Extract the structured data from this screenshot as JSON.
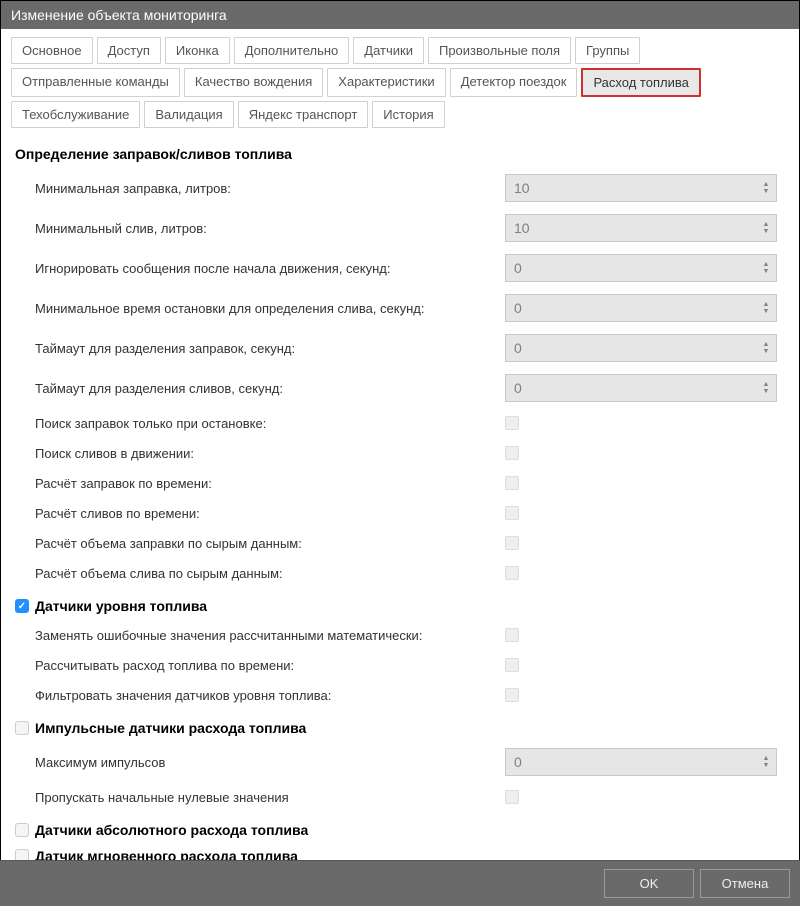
{
  "title": "Изменение объекта мониторинга",
  "tabs": {
    "row1": [
      {
        "label": "Основное",
        "active": false
      },
      {
        "label": "Доступ",
        "active": false
      },
      {
        "label": "Иконка",
        "active": false
      },
      {
        "label": "Дополнительно",
        "active": false
      },
      {
        "label": "Датчики",
        "active": false
      },
      {
        "label": "Произвольные поля",
        "active": false
      },
      {
        "label": "Группы",
        "active": false
      }
    ],
    "row2": [
      {
        "label": "Отправленные команды",
        "active": false
      },
      {
        "label": "Качество вождения",
        "active": false
      },
      {
        "label": "Характеристики",
        "active": false
      },
      {
        "label": "Детектор поездок",
        "active": false
      },
      {
        "label": "Расход топлива",
        "active": true
      }
    ],
    "row3": [
      {
        "label": "Техобслуживание",
        "active": false
      },
      {
        "label": "Валидация",
        "active": false
      },
      {
        "label": "Яндекс транспорт",
        "active": false
      },
      {
        "label": "История",
        "active": false
      }
    ]
  },
  "sections": {
    "s1": {
      "title": "Определение заправок/сливов топлива",
      "rows": [
        {
          "label": "Минимальная заправка, литров:",
          "type": "spinner",
          "value": "10"
        },
        {
          "label": "Минимальный слив, литров:",
          "type": "spinner",
          "value": "10"
        },
        {
          "label": "Игнорировать сообщения после начала движения, секунд:",
          "type": "spinner",
          "value": "0"
        },
        {
          "label": "Минимальное время остановки для определения слива, секунд:",
          "type": "spinner",
          "value": "0"
        },
        {
          "label": "Таймаут для разделения заправок, секунд:",
          "type": "spinner",
          "value": "0"
        },
        {
          "label": "Таймаут для разделения сливов, секунд:",
          "type": "spinner",
          "value": "0"
        },
        {
          "label": "Поиск заправок только при остановке:",
          "type": "checkbox"
        },
        {
          "label": "Поиск сливов в движении:",
          "type": "checkbox"
        },
        {
          "label": "Расчёт заправок по времени:",
          "type": "checkbox"
        },
        {
          "label": "Расчёт сливов по времени:",
          "type": "checkbox"
        },
        {
          "label": "Расчёт объема заправки по сырым данным:",
          "type": "checkbox"
        },
        {
          "label": "Расчёт объема слива по сырым данным:",
          "type": "checkbox"
        }
      ]
    },
    "s2": {
      "title": "Датчики уровня топлива",
      "checked": true,
      "rows": [
        {
          "label": "Заменять ошибочные значения рассчитанными математически:",
          "type": "checkbox"
        },
        {
          "label": "Рассчитывать расход топлива по времени:",
          "type": "checkbox"
        },
        {
          "label": "Фильтровать значения датчиков уровня топлива:",
          "type": "checkbox"
        }
      ]
    },
    "s3": {
      "title": "Импульсные датчики расхода топлива",
      "checked": false,
      "rows": [
        {
          "label": "Максимум импульсов",
          "type": "spinner",
          "value": "0"
        },
        {
          "label": "Пропускать начальные нулевые значения",
          "type": "checkbox"
        }
      ]
    },
    "s4": {
      "title": "Датчики абсолютного расхода топлива",
      "checked": false,
      "rows": []
    },
    "s5": {
      "title": "Датчик мгновенного расхода топлива",
      "checked": false,
      "rows": []
    }
  },
  "footer": {
    "ok": "OK",
    "cancel": "Отмена"
  }
}
